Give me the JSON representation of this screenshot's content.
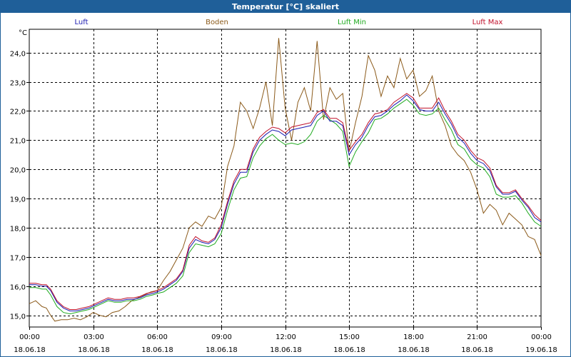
{
  "window": {
    "title": "Temperatur [°C] skaliert"
  },
  "chart_data": {
    "type": "line",
    "title": "Temperatur [°C] skaliert",
    "ylabel": "°C",
    "xlabel": "",
    "ylim": [
      14.6,
      24.8
    ],
    "xlim": [
      0,
      24
    ],
    "grid": true,
    "legend_position": "top",
    "y_ticks": [
      "15,0",
      "16,0",
      "17,0",
      "18,0",
      "19,0",
      "20,0",
      "21,0",
      "22,0",
      "23,0",
      "24,0"
    ],
    "y_tick_values": [
      15,
      16,
      17,
      18,
      19,
      20,
      21,
      22,
      23,
      24
    ],
    "x_ticks": [
      {
        "time": "00:00",
        "date": "18.06.18"
      },
      {
        "time": "03:00",
        "date": "18.06.18"
      },
      {
        "time": "06:00",
        "date": "18.06.18"
      },
      {
        "time": "09:00",
        "date": "18.06.18"
      },
      {
        "time": "12:00",
        "date": "18.06.18"
      },
      {
        "time": "15:00",
        "date": "18.06.18"
      },
      {
        "time": "18:00",
        "date": "18.06.18"
      },
      {
        "time": "21:00",
        "date": "18.06.18"
      },
      {
        "time": "00:00",
        "date": "19.06.18"
      }
    ],
    "series": [
      {
        "name": "Luft",
        "color": "#1a1ab0",
        "x": [
          0,
          0.3,
          0.6,
          0.8,
          1.0,
          1.3,
          1.6,
          1.9,
          2.2,
          2.5,
          2.8,
          3.1,
          3.4,
          3.7,
          4.0,
          4.3,
          4.6,
          4.9,
          5.2,
          5.5,
          5.8,
          6.0,
          6.3,
          6.6,
          6.9,
          7.2,
          7.5,
          7.8,
          8.1,
          8.4,
          8.7,
          9.0,
          9.3,
          9.6,
          9.9,
          10.2,
          10.5,
          10.8,
          11.1,
          11.4,
          11.7,
          12.0,
          12.3,
          12.6,
          12.9,
          13.2,
          13.5,
          13.8,
          14.1,
          14.4,
          14.7,
          15.0,
          15.3,
          15.6,
          15.9,
          16.2,
          16.5,
          16.8,
          17.1,
          17.4,
          17.7,
          18.0,
          18.3,
          18.6,
          18.9,
          19.2,
          19.5,
          19.8,
          20.1,
          20.4,
          20.7,
          21.0,
          21.3,
          21.6,
          21.9,
          22.2,
          22.5,
          22.8,
          23.1,
          23.4,
          23.7,
          24.0
        ],
        "values": [
          16.05,
          16.05,
          16.0,
          16.0,
          15.85,
          15.45,
          15.25,
          15.15,
          15.15,
          15.2,
          15.25,
          15.35,
          15.45,
          15.55,
          15.5,
          15.5,
          15.55,
          15.55,
          15.6,
          15.7,
          15.75,
          15.8,
          15.9,
          16.05,
          16.2,
          16.5,
          17.3,
          17.6,
          17.5,
          17.45,
          17.6,
          18.0,
          18.8,
          19.5,
          19.9,
          19.9,
          20.6,
          21.0,
          21.2,
          21.35,
          21.3,
          21.15,
          21.35,
          21.4,
          21.45,
          21.5,
          21.85,
          22.0,
          21.65,
          21.65,
          21.5,
          20.5,
          20.85,
          21.1,
          21.5,
          21.8,
          21.85,
          22.0,
          22.2,
          22.35,
          22.55,
          22.35,
          22.05,
          22.0,
          22.0,
          22.3,
          21.9,
          21.55,
          21.1,
          20.9,
          20.55,
          20.3,
          20.2,
          19.95,
          19.4,
          19.15,
          19.15,
          19.25,
          18.95,
          18.7,
          18.35,
          18.2
        ]
      },
      {
        "name": "Boden",
        "color": "#8b5a1a",
        "x": [
          0,
          0.3,
          0.6,
          0.8,
          1.0,
          1.2,
          1.5,
          1.8,
          2.1,
          2.4,
          2.7,
          3.0,
          3.3,
          3.6,
          3.9,
          4.2,
          4.5,
          4.8,
          5.1,
          5.4,
          5.7,
          6.0,
          6.3,
          6.6,
          6.9,
          7.2,
          7.5,
          7.8,
          8.1,
          8.4,
          8.7,
          9.0,
          9.3,
          9.6,
          9.9,
          10.2,
          10.5,
          10.8,
          11.1,
          11.4,
          11.7,
          12.0,
          12.3,
          12.6,
          12.9,
          13.2,
          13.5,
          13.8,
          14.1,
          14.4,
          14.7,
          15.0,
          15.3,
          15.6,
          15.9,
          16.2,
          16.5,
          16.8,
          17.1,
          17.4,
          17.7,
          18.0,
          18.3,
          18.6,
          18.9,
          19.2,
          19.5,
          19.8,
          20.1,
          20.4,
          20.7,
          21.0,
          21.3,
          21.6,
          21.9,
          22.2,
          22.5,
          22.8,
          23.1,
          23.4,
          23.7,
          24.0
        ],
        "values": [
          15.4,
          15.5,
          15.3,
          15.25,
          15.0,
          14.8,
          14.85,
          14.85,
          14.9,
          14.85,
          14.95,
          15.1,
          15.0,
          14.95,
          15.1,
          15.15,
          15.3,
          15.5,
          15.6,
          15.7,
          15.8,
          15.85,
          16.2,
          16.5,
          16.9,
          17.3,
          18.0,
          18.2,
          18.05,
          18.4,
          18.3,
          18.7,
          20.1,
          20.8,
          22.3,
          22.0,
          21.4,
          22.1,
          23.0,
          21.5,
          24.5,
          22.1,
          21.0,
          22.3,
          22.8,
          22.0,
          24.4,
          21.7,
          22.8,
          22.4,
          22.6,
          20.6,
          21.6,
          22.5,
          23.9,
          23.4,
          22.5,
          23.2,
          22.8,
          23.8,
          23.1,
          23.4,
          22.5,
          22.7,
          23.2,
          22.0,
          21.5,
          20.8,
          20.5,
          20.3,
          19.9,
          19.3,
          18.5,
          18.8,
          18.6,
          18.1,
          18.5,
          18.3,
          18.1,
          17.7,
          17.6,
          17.05
        ]
      },
      {
        "name": "Luft Min",
        "color": "#1faa1f",
        "x": [
          0,
          0.3,
          0.6,
          0.8,
          1.0,
          1.3,
          1.6,
          1.9,
          2.2,
          2.5,
          2.8,
          3.1,
          3.4,
          3.7,
          4.0,
          4.3,
          4.6,
          4.9,
          5.2,
          5.5,
          5.8,
          6.0,
          6.3,
          6.6,
          6.9,
          7.2,
          7.5,
          7.8,
          8.1,
          8.4,
          8.7,
          9.0,
          9.3,
          9.6,
          9.9,
          10.2,
          10.5,
          10.8,
          11.1,
          11.4,
          11.7,
          12.0,
          12.3,
          12.6,
          12.9,
          13.2,
          13.5,
          13.8,
          14.1,
          14.4,
          14.7,
          15.0,
          15.3,
          15.6,
          15.9,
          16.2,
          16.5,
          16.8,
          17.1,
          17.4,
          17.7,
          18.0,
          18.3,
          18.6,
          18.9,
          19.2,
          19.5,
          19.8,
          20.1,
          20.4,
          20.7,
          21.0,
          21.3,
          21.6,
          21.9,
          22.2,
          22.5,
          22.8,
          23.1,
          23.4,
          23.7,
          24.0
        ],
        "values": [
          15.95,
          15.95,
          15.9,
          15.9,
          15.7,
          15.3,
          15.1,
          15.05,
          15.1,
          15.15,
          15.2,
          15.3,
          15.4,
          15.5,
          15.45,
          15.45,
          15.5,
          15.5,
          15.55,
          15.65,
          15.7,
          15.75,
          15.8,
          15.95,
          16.1,
          16.35,
          17.15,
          17.45,
          17.4,
          17.35,
          17.45,
          17.8,
          18.6,
          19.3,
          19.7,
          19.75,
          20.4,
          20.8,
          21.05,
          21.2,
          21.0,
          20.85,
          20.9,
          20.85,
          20.95,
          21.2,
          21.65,
          21.85,
          21.7,
          21.55,
          21.3,
          20.1,
          20.6,
          20.95,
          21.25,
          21.7,
          21.75,
          21.9,
          22.1,
          22.25,
          22.4,
          22.2,
          21.9,
          21.85,
          21.9,
          22.1,
          21.7,
          21.35,
          20.85,
          20.7,
          20.35,
          20.15,
          20.05,
          19.75,
          19.15,
          19.05,
          19.05,
          19.1,
          18.85,
          18.5,
          18.2,
          18.05
        ]
      },
      {
        "name": "Luft Max",
        "color": "#c0102a",
        "x": [
          0,
          0.3,
          0.6,
          0.8,
          1.0,
          1.3,
          1.6,
          1.9,
          2.2,
          2.5,
          2.8,
          3.1,
          3.4,
          3.7,
          4.0,
          4.3,
          4.6,
          4.9,
          5.2,
          5.5,
          5.8,
          6.0,
          6.3,
          6.6,
          6.9,
          7.2,
          7.5,
          7.8,
          8.1,
          8.4,
          8.7,
          9.0,
          9.3,
          9.6,
          9.9,
          10.2,
          10.5,
          10.8,
          11.1,
          11.4,
          11.7,
          12.0,
          12.3,
          12.6,
          12.9,
          13.2,
          13.5,
          13.8,
          14.1,
          14.4,
          14.7,
          15.0,
          15.3,
          15.6,
          15.9,
          16.2,
          16.5,
          16.8,
          17.1,
          17.4,
          17.7,
          18.0,
          18.3,
          18.6,
          18.9,
          19.2,
          19.5,
          19.8,
          20.1,
          20.4,
          20.7,
          21.0,
          21.3,
          21.6,
          21.9,
          22.2,
          22.5,
          22.8,
          23.1,
          23.4,
          23.7,
          24.0
        ],
        "values": [
          16.1,
          16.1,
          16.05,
          16.05,
          15.9,
          15.5,
          15.3,
          15.2,
          15.2,
          15.25,
          15.3,
          15.4,
          15.5,
          15.6,
          15.55,
          15.55,
          15.6,
          15.6,
          15.65,
          15.75,
          15.8,
          15.85,
          15.95,
          16.1,
          16.25,
          16.55,
          17.4,
          17.7,
          17.55,
          17.5,
          17.65,
          18.1,
          18.9,
          19.6,
          20.0,
          20.0,
          20.7,
          21.1,
          21.3,
          21.45,
          21.4,
          21.25,
          21.45,
          21.5,
          21.55,
          21.6,
          21.95,
          22.05,
          21.75,
          21.75,
          21.6,
          20.65,
          20.95,
          21.2,
          21.6,
          21.9,
          21.95,
          22.05,
          22.3,
          22.45,
          22.6,
          22.45,
          22.1,
          22.1,
          22.1,
          22.45,
          22.0,
          21.65,
          21.2,
          21.0,
          20.65,
          20.4,
          20.3,
          20.05,
          19.45,
          19.2,
          19.2,
          19.3,
          19.0,
          18.75,
          18.45,
          18.25
        ]
      }
    ]
  }
}
